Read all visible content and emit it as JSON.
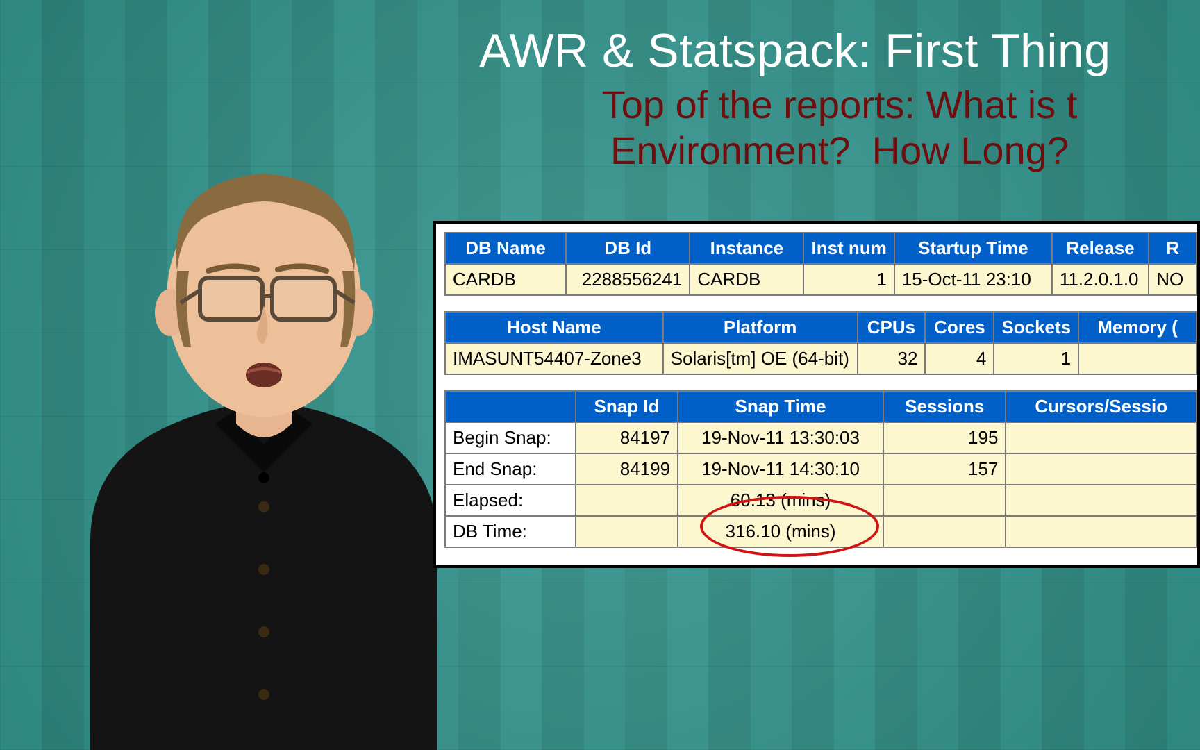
{
  "slide": {
    "title": "AWR & Statspack: First Thing",
    "subtitle": "Top of the reports: What is t\nEnvironment?  How Long?"
  },
  "db_table": {
    "headers": [
      "DB Name",
      "DB Id",
      "Instance",
      "Inst num",
      "Startup Time",
      "Release",
      "R"
    ],
    "row": {
      "db_name": "CARDB",
      "db_id": "2288556241",
      "instance": "CARDB",
      "inst_num": "1",
      "startup_time": "15-Oct-11 23:10",
      "release": "11.2.0.1.0",
      "rac": "NO"
    }
  },
  "host_table": {
    "headers": [
      "Host Name",
      "Platform",
      "CPUs",
      "Cores",
      "Sockets",
      "Memory ("
    ],
    "row": {
      "host_name": "IMASUNT54407-Zone3",
      "platform": "Solaris[tm] OE (64-bit)",
      "cpus": "32",
      "cores": "4",
      "sockets": "1",
      "memory": ""
    }
  },
  "snap_table": {
    "headers": [
      "",
      "Snap Id",
      "Snap Time",
      "Sessions",
      "Cursors/Sessio"
    ],
    "rows": [
      {
        "label": "Begin Snap:",
        "snap_id": "84197",
        "snap_time": "19-Nov-11 13:30:03",
        "sessions": "195",
        "cursors": ""
      },
      {
        "label": "End Snap:",
        "snap_id": "84199",
        "snap_time": "19-Nov-11 14:30:10",
        "sessions": "157",
        "cursors": ""
      },
      {
        "label": "Elapsed:",
        "snap_id": "",
        "snap_time": "60.13 (mins)",
        "sessions": "",
        "cursors": ""
      },
      {
        "label": "DB Time:",
        "snap_id": "",
        "snap_time": "316.10 (mins)",
        "sessions": "",
        "cursors": ""
      }
    ]
  },
  "annotation": {
    "circled_values": [
      "60.13 (mins)",
      "316.10 (mins)"
    ]
  }
}
